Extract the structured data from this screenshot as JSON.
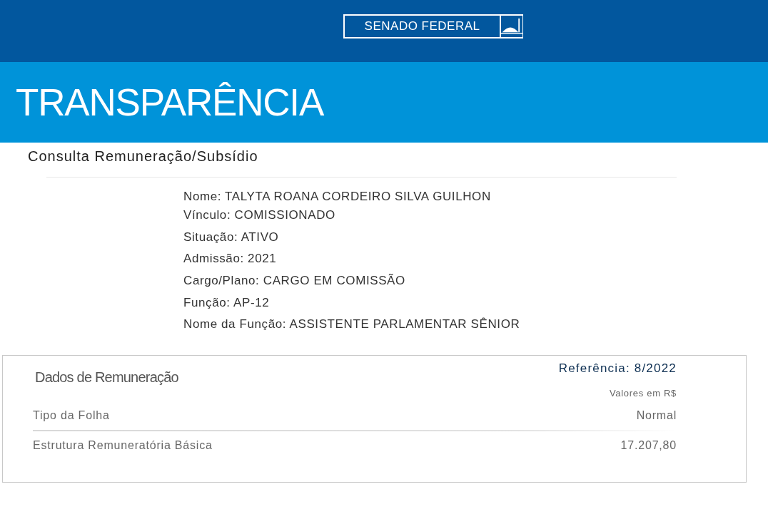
{
  "header": {
    "brand": "SENADO FEDERAL"
  },
  "banner": {
    "title": "TRANSPARÊNCIA"
  },
  "page_title": "Consulta Remuneração/Subsídio",
  "details": [
    "Nome: TALYTA ROANA CORDEIRO SILVA GUILHON",
    "Vínculo: COMISSIONADO",
    "Situação: ATIVO",
    "Admissão: 2021",
    "Cargo/Plano: CARGO EM COMISSÃO",
    "Função: AP-12",
    "Nome da Função: ASSISTENTE PARLAMENTAR SÊNIOR"
  ],
  "remuneration": {
    "title": "Dados de Remuneração",
    "reference": "Referência: 8/2022",
    "currency_note": "Valores em R$",
    "rows": [
      {
        "label": "Tipo da Folha",
        "value": "Normal"
      },
      {
        "label": "Estrutura Remuneratória Básica",
        "value": "17.207,80"
      }
    ]
  }
}
